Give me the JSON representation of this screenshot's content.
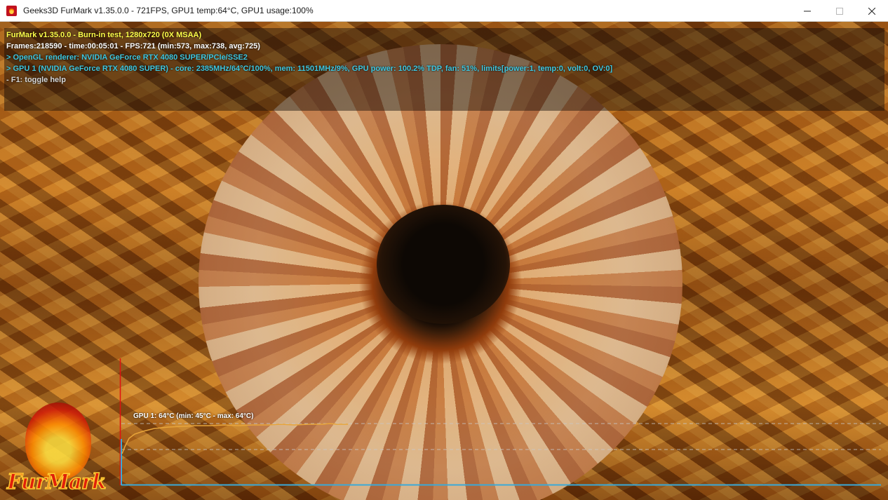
{
  "window": {
    "title": "Geeks3D FurMark v1.35.0.0 - 721FPS, GPU1 temp:64°C, GPU1 usage:100%",
    "controls": [
      "minimize",
      "maximize",
      "close"
    ]
  },
  "osd": {
    "line1": "FurMark v1.35.0.0 - Burn-in test, 1280x720 (0X MSAA)",
    "line2": "Frames:218590 - time:00:05:01 - FPS:721 (min:573, max:738, avg:725)",
    "line3": "> OpenGL renderer: NVIDIA GeForce RTX 4080 SUPER/PCIe/SSE2",
    "line4": "> GPU 1 (NVIDIA GeForce RTX 4080 SUPER) - core: 2385MHz/64°C/100%, mem: 11501MHz/9%, GPU power: 100.2% TDP, fan: 51%, limits[power:1, temp:0, volt:0, OV:0]",
    "line5": "- F1: toggle help",
    "colors": {
      "title": "#ffff4a",
      "stats": "#ffffff",
      "info": "#3fc7e0",
      "help": "#d8d8d8"
    }
  },
  "graph": {
    "label": "GPU 1: 64°C (min: 45°C - max: 64°C)",
    "line_color": "#e8a53a",
    "axis_color": "#3aa9d8",
    "marker_color": "#e01010"
  },
  "logo": {
    "text": "FurMark",
    "icon": "furmark-flame-icon"
  }
}
